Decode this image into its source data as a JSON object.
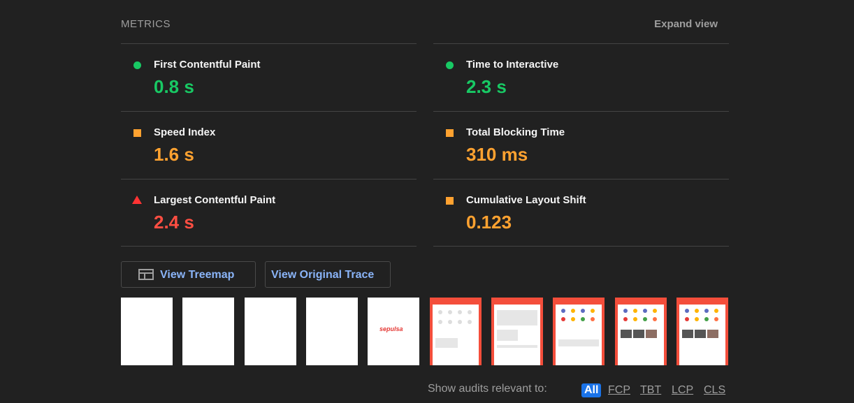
{
  "header": {
    "title": "METRICS",
    "expand_label": "Expand view"
  },
  "metrics": {
    "fcp": {
      "label": "First Contentful Paint",
      "value": "0.8 s",
      "status": "pass",
      "color": "#18c964"
    },
    "tti": {
      "label": "Time to Interactive",
      "value": "2.3 s",
      "status": "pass",
      "color": "#18c964"
    },
    "si": {
      "label": "Speed Index",
      "value": "1.6 s",
      "status": "average",
      "color": "#ffa230"
    },
    "tbt": {
      "label": "Total Blocking Time",
      "value": "310 ms",
      "status": "average",
      "color": "#ffa230"
    },
    "lcp": {
      "label": "Largest Contentful Paint",
      "value": "2.4 s",
      "status": "fail",
      "color": "#ff4e42"
    },
    "cls": {
      "label": "Cumulative Layout Shift",
      "value": "0.123",
      "status": "average",
      "color": "#ffa230"
    }
  },
  "buttons": {
    "treemap": "View Treemap",
    "trace": "View Original Trace"
  },
  "filmstrip": {
    "logo_text": "sepulsa"
  },
  "filter": {
    "label": "Show audits relevant to:",
    "chips": [
      "All",
      "FCP",
      "TBT",
      "LCP",
      "CLS"
    ]
  }
}
